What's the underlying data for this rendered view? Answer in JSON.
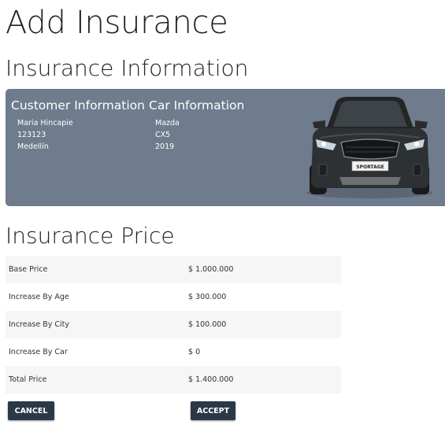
{
  "page": {
    "title": "Add Insurance"
  },
  "insurance_information": {
    "title": "Insurance Information",
    "customer": {
      "heading": "Customer Information",
      "name": "Maria Hincapie",
      "id": "123123",
      "city": "Medellín"
    },
    "car": {
      "heading": "Car Information",
      "brand": "Mazda",
      "model": "CX5",
      "year": "2019",
      "plate_text": "SPORTAGE"
    },
    "card_color": "#6e7c8d"
  },
  "insurance_price": {
    "title": "Insurance Price",
    "rows": [
      {
        "label": "Base Price",
        "value": "$ 1.000.000"
      },
      {
        "label": "Increase By Age",
        "value": "$ 300.000"
      },
      {
        "label": "Increase By City",
        "value": "$ 100.000"
      },
      {
        "label": "Increase By Car",
        "value": "$ 0"
      },
      {
        "label": "Total Price",
        "value": "$ 1.400.000"
      }
    ]
  },
  "actions": {
    "cancel_label": "CANCEL",
    "accept_label": "ACCEPT",
    "button_color": "#2b3947"
  }
}
